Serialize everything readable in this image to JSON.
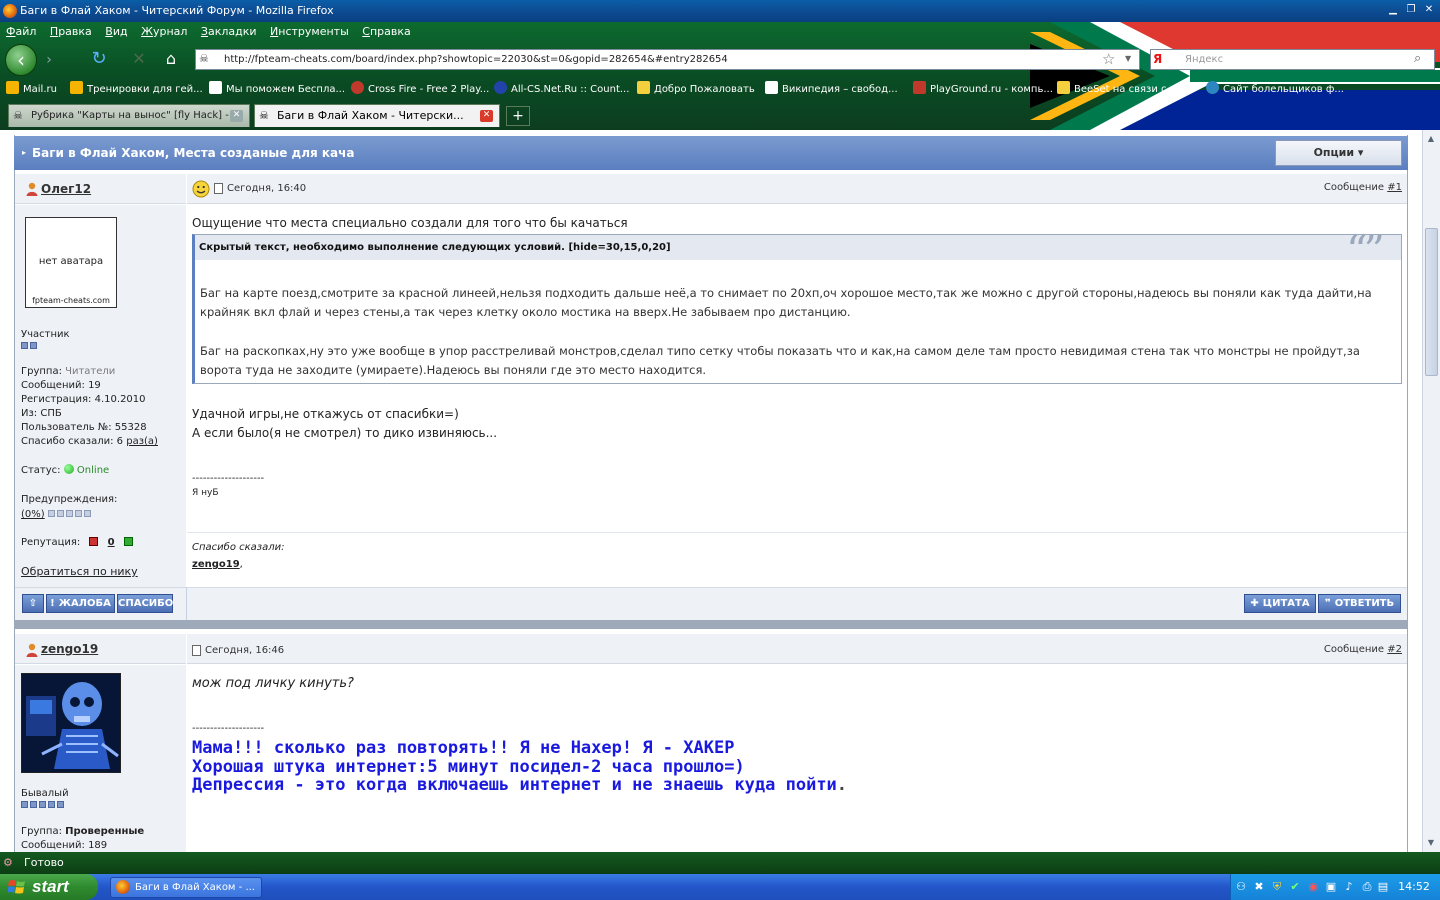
{
  "window": {
    "title": "Баги в Флай Хаком - Читерский Форум - Mozilla Firefox",
    "min": "▁",
    "max": "❐",
    "close": "✕"
  },
  "menu": [
    "Файл",
    "Правка",
    "Вид",
    "Журнал",
    "Закладки",
    "Инструменты",
    "Справка"
  ],
  "nav": {
    "url": "http://fpteam-cheats.com/board/index.php?showtopic=22030&st=0&gopid=282654&#entry282654",
    "search_placeholder": "Яндекс",
    "search_engine_letter": "Я"
  },
  "bookmarks": [
    {
      "label": "Mail.ru",
      "color": "#f4b400"
    },
    {
      "label": "Тренировки для гей...",
      "color": "#f4b400"
    },
    {
      "label": "Мы поможем Бесплa...",
      "color": "#f4b400"
    },
    {
      "label": "Cross Fire - Free 2 Play...",
      "color": "#c0392b"
    },
    {
      "label": "All-CS.Net.Ru :: Count...",
      "color": "#2244aa"
    },
    {
      "label": "Добро Пожаловать",
      "color": "#f4d03f"
    },
    {
      "label": "Википедия – свобод...",
      "color": "#ffffff"
    },
    {
      "label": "PlayGround.ru - компь...",
      "color": "#c0392b"
    },
    {
      "label": "BeeSet на связи с то...",
      "color": "#f4d03f"
    },
    {
      "label": "Сайт болельщиков ф...",
      "color": "#2e86c1"
    }
  ],
  "tabs": [
    {
      "label": "Рубрика \"Карты на вынос\" [fly Hack] - ...",
      "active": false
    },
    {
      "label": "Баги в Флай Хаком - Читерски...",
      "active": true
    }
  ],
  "topic": {
    "title": "Баги в Флай Хаком, Места созданые для кача",
    "options_label": "Опции ▾"
  },
  "post1": {
    "username": "Олег12",
    "date": "Сегодня, 16:40",
    "post_label": "Сообщение",
    "post_num": "#1",
    "avatar_text": "нет аватара",
    "avatar_site": "fpteam-cheats.com",
    "rank": "Участник",
    "group_label": "Группа:",
    "group": "Читатели",
    "messages_label": "Сообщений:",
    "messages": "19",
    "reg_label": "Регистрация:",
    "reg": "4.10.2010",
    "from_label": "Из:",
    "from": "СПБ",
    "user_no_label": "Пользователь №:",
    "user_no": "55328",
    "thanks_label": "Спасибо сказали:",
    "thanks_count": "6",
    "thanks_unit": "раз(а)",
    "status_label": "Статус:",
    "status": "Online",
    "warn_label": "Предупреждения:",
    "warn_value": "(0%)",
    "rep_label": "Репутация:",
    "rep_value": "0",
    "address_link": "Обратиться по нику",
    "body_line1": "Ощущение что места специально создали для того что бы качаться",
    "hidden_header": "Скрытый текст, необходимо выполнение следующих условий. [hide=30,15,0,20]",
    "hidden_p1": "Баг на карте поезд,смотрите за красной линеей,нельзя подходить дальше неё,а то снимает по 20хп,оч хорошое место,так же можно с другой стороны,надеюсь вы поняли как туда дайти,на крайняк вкл флай и через стены,а так через клетку около мостика на вверх.Не забываем про дистанцию.",
    "hidden_p2": "Баг на раскопках,ну это уже вообще в упор расстреливай монстров,сделал типо сетку чтобы показать что и как,на самом деле там просто невидимая стена так что монстры не пройдут,за ворота туда не заходите (умираете).Надеюсь вы поняли где это место находится.",
    "body_line2": "Удачной игры,не откажусь от спасибки=)",
    "body_line3": "А если было(я не смотрел) то дико извиняюсь...",
    "sig_divider": "--------------------",
    "signature": "Я нуБ",
    "thanks_title": "Спасибо сказали:",
    "thanks_users": "zengo19",
    "btn_report": "ЖАЛОБА",
    "btn_thanks": "СПАСИБО",
    "btn_quote": "ЦИТАТА",
    "btn_reply": "ОТВЕТИТЬ"
  },
  "post2": {
    "username": "zengo19",
    "date": "Сегодня, 16:46",
    "post_label": "Сообщение",
    "post_num": "#2",
    "rank": "Бывалый",
    "group_label": "Группа:",
    "group": "Проверенные",
    "messages_label": "Сообщений:",
    "messages": "189",
    "body": "мож под личку кинуть?",
    "sig_divider": "--------------------",
    "sig1": "Мама!!! сколько раз повторять!! Я не Нахер! Я - ХАКЕР",
    "sig2": "Хорошая штука интернет:5 минут посидел-2 часа прошло=)",
    "sig3": "Депрессия - это когда включаешь интернет и не знаешь куда пойти",
    "sig3_dot": "."
  },
  "status": {
    "text": "Готово"
  },
  "taskbar": {
    "start": "start",
    "task": "Баги в Флай Хаком - ...",
    "clock": "14:52"
  }
}
